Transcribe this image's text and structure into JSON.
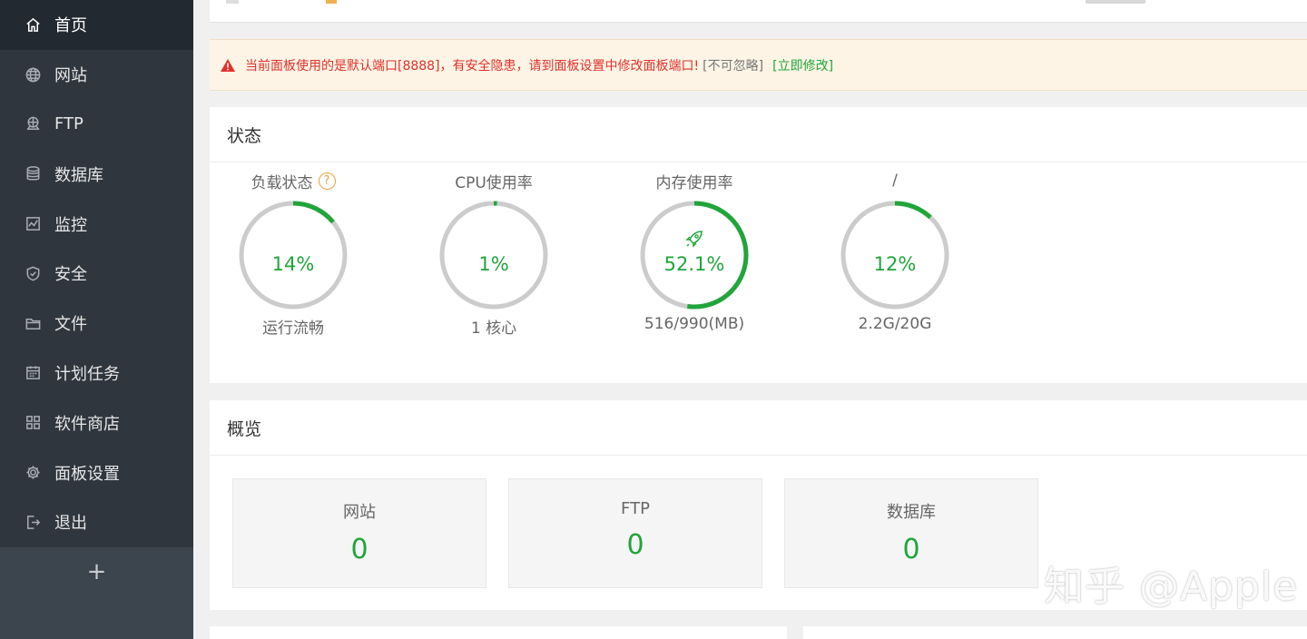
{
  "sidebar": {
    "items": [
      {
        "label": "首页",
        "icon": "home-icon",
        "active": true
      },
      {
        "label": "网站",
        "icon": "globe-icon"
      },
      {
        "label": "FTP",
        "icon": "ftp-icon"
      },
      {
        "label": "数据库",
        "icon": "database-icon"
      },
      {
        "label": "监控",
        "icon": "monitor-chart-icon"
      },
      {
        "label": "安全",
        "icon": "shield-icon"
      },
      {
        "label": "文件",
        "icon": "folder-icon"
      },
      {
        "label": "计划任务",
        "icon": "calendar-icon"
      },
      {
        "label": "软件商店",
        "icon": "apps-grid-icon"
      },
      {
        "label": "面板设置",
        "icon": "gear-icon"
      },
      {
        "label": "退出",
        "icon": "logout-icon"
      }
    ],
    "add_label": "+"
  },
  "alert": {
    "message": "当前面板使用的是默认端口[8888]，有安全隐患，请到面板设置中修改面板端口!",
    "ignore": "[不可忽略]",
    "fix": "[立即修改]"
  },
  "status": {
    "title": "状态",
    "gauges": [
      {
        "title": "负载状态",
        "value_text": "14%",
        "percent": 14,
        "sub": "运行流畅",
        "has_help": true,
        "help_label": "?"
      },
      {
        "title": "CPU使用率",
        "value_text": "1%",
        "percent": 1,
        "sub": "1 核心"
      },
      {
        "title": "内存使用率",
        "value_text": "52.1%",
        "percent": 52.1,
        "sub": "516/990(MB)",
        "has_rocket": true
      },
      {
        "title": "/",
        "value_text": "12%",
        "percent": 12,
        "sub": "2.2G/20G"
      }
    ]
  },
  "overview": {
    "title": "概览",
    "cards": [
      {
        "label": "网站",
        "count": "0"
      },
      {
        "label": "FTP",
        "count": "0"
      },
      {
        "label": "数据库",
        "count": "0"
      }
    ]
  },
  "watermark": "知乎 @Apple",
  "colors": {
    "accent_green": "#20a53a",
    "alert_red": "#e0312a",
    "sidebar_bg": "#2f363e",
    "sidebar_active": "#222931",
    "ring_track": "#cccccc"
  }
}
